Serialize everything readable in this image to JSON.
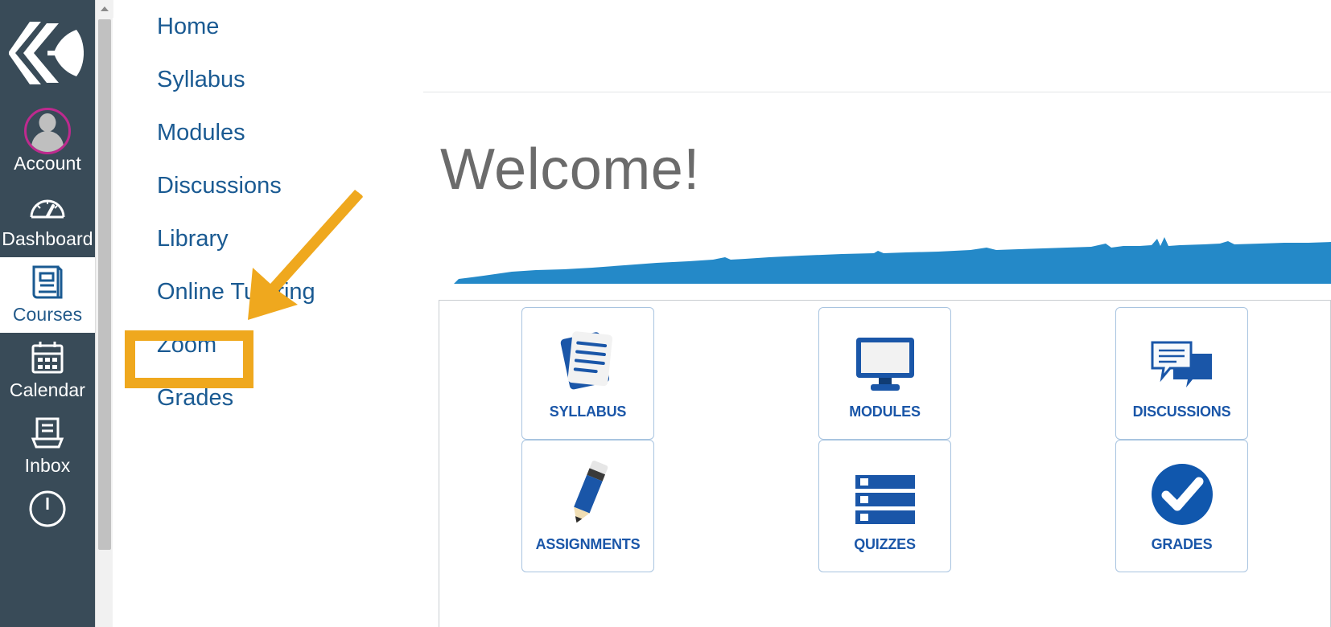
{
  "global_nav": {
    "logo_icon": "canvas-diamond-logo-icon",
    "items": [
      {
        "label": "Account",
        "icon": "user-avatar-icon",
        "active": false
      },
      {
        "label": "Dashboard",
        "icon": "speedometer-icon",
        "active": false
      },
      {
        "label": "Courses",
        "icon": "book-icon",
        "active": true
      },
      {
        "label": "Calendar",
        "icon": "calendar-icon",
        "active": false
      },
      {
        "label": "Inbox",
        "icon": "inbox-tray-icon",
        "active": false
      },
      {
        "label": "",
        "icon": "history-clock-icon",
        "active": false
      }
    ],
    "avatar_ring_color": "#BE2A8E",
    "background_color": "#394B58",
    "active_label_color": "#235A8A"
  },
  "scrollbar": {
    "up_arrow_icon": "chevron-up-icon",
    "thumb_color": "#C1C1C1",
    "track_color": "#F1F1F1"
  },
  "course_nav": {
    "link_color": "#1A5A92",
    "items": [
      {
        "label": "Home"
      },
      {
        "label": "Syllabus"
      },
      {
        "label": "Modules"
      },
      {
        "label": "Discussions"
      },
      {
        "label": "Library"
      },
      {
        "label": "Online Tutoring"
      },
      {
        "label": "Zoom"
      },
      {
        "label": "Grades"
      }
    ]
  },
  "main": {
    "heading": "Welcome!",
    "heading_color": "#6B6B6B",
    "banner_icon": "blue-wave-banner-icon",
    "banner_color": "#2489C8",
    "tiles": [
      {
        "label": "SYLLABUS",
        "icon": "stacked-documents-icon"
      },
      {
        "label": "MODULES",
        "icon": "desktop-monitor-icon"
      },
      {
        "label": "DISCUSSIONS",
        "icon": "speech-bubbles-icon"
      },
      {
        "label": "ASSIGNMENTS",
        "icon": "pencil-icon"
      },
      {
        "label": "QUIZZES",
        "icon": "checklist-bars-icon"
      },
      {
        "label": "GRADES",
        "icon": "check-circle-icon"
      }
    ],
    "tile_label_color": "#1A56A8",
    "tile_border_color": "#A8C4E0"
  },
  "annotations": {
    "highlight_color": "#EFA81E",
    "highlight_target": "Zoom",
    "arrow_icon": "arrow-pointing-down-left-icon"
  }
}
